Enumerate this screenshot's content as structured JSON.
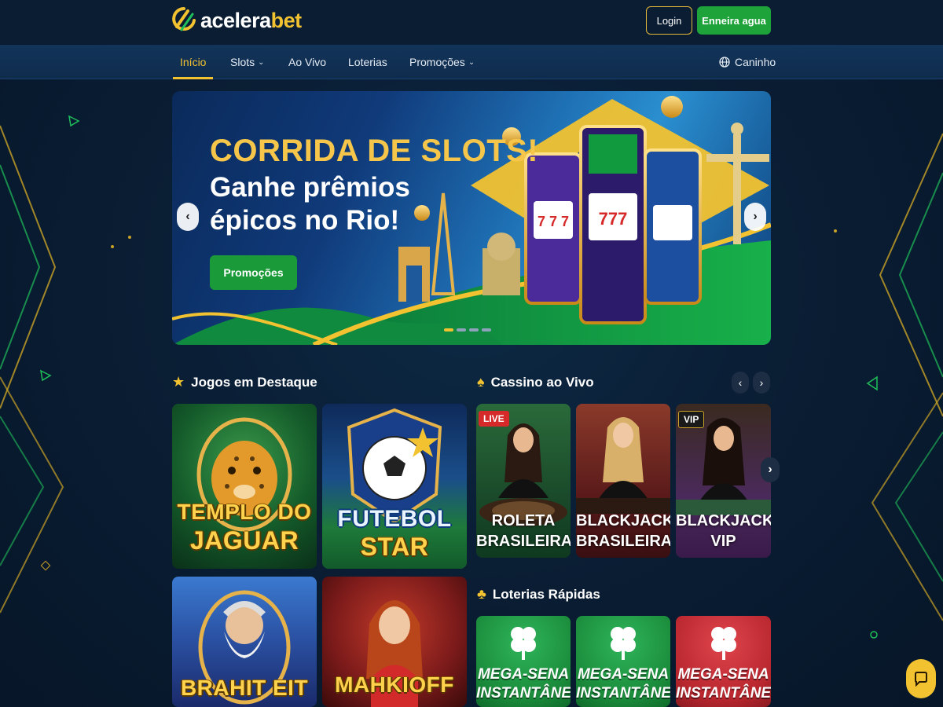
{
  "header": {
    "logo_prefix": "acelera",
    "logo_suffix": "bet",
    "login_label": "Login",
    "signup_label": "Enneira agua"
  },
  "nav": {
    "items": [
      {
        "label": "Início",
        "active": true
      },
      {
        "label": "Slots",
        "dropdown": true
      },
      {
        "label": "Ao Vivo"
      },
      {
        "label": "Loterias"
      },
      {
        "label": "Promoções",
        "dropdown": true
      }
    ],
    "right_label": "Caninho"
  },
  "hero": {
    "title": "CORRIDA DE SLOTS!",
    "subtitle": "Ganhe prêmios épicos no Rio!",
    "cta_label": "Promoções",
    "slides_count": 4,
    "active_slide": 1
  },
  "featured": {
    "heading": "Jogos em Destaque",
    "games": [
      {
        "title_line1": "TEMPLO DO",
        "title_line2": "JAGUAR"
      },
      {
        "title_line1": "FUTEBOL",
        "title_line2": "STAR"
      },
      {
        "title_line1": "BRAHIT EIT",
        "title_line2": ""
      },
      {
        "title_line1": "MAHKIOFF",
        "title_line2": ""
      }
    ]
  },
  "live_casino": {
    "heading": "Cassino ao Vivo",
    "tables": [
      {
        "badge": "LIVE",
        "title_line1": "ROLETA",
        "title_line2": "BRASILEIRA"
      },
      {
        "badge": "",
        "title_line1": "BLACKJACK",
        "title_line2": "BRASILEIRA"
      },
      {
        "badge": "VIP",
        "title_line1": "BLACKJACK",
        "title_line2": "VIP"
      }
    ]
  },
  "lotteries": {
    "heading": "Loterias Rápidas",
    "items": [
      {
        "title_line1": "MEGA-SENA",
        "title_line2": "INSTANTÂNEA",
        "color": "#1f9a45"
      },
      {
        "title_line1": "MEGA-SENA",
        "title_line2": "INSTANTÂNEA",
        "color": "#1f9a45"
      },
      {
        "title_line1": "MEGA-SENA",
        "title_line2": "INSTANTÂNEA",
        "color": "#c2303a"
      }
    ]
  },
  "colors": {
    "accent": "#f2c230",
    "green": "#1ea23a",
    "background": "#0a1e35"
  }
}
